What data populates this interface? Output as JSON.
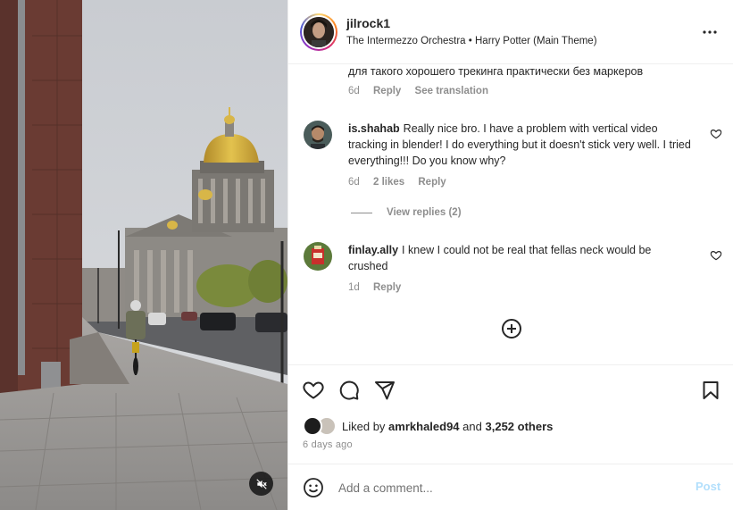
{
  "post": {
    "username": "jilrock1",
    "audio": "The Intermezzo Orchestra • Harry Potter (Main Theme)",
    "more_icon": "more-horizontal-icon"
  },
  "comments": [
    {
      "username": "",
      "text": "для такого хорошего трекинга практически без маркеров",
      "time": "6d",
      "likes": "",
      "reply": "Reply",
      "translate": "See translation"
    },
    {
      "username": "is.shahab",
      "text": "Really nice bro. I have a problem with vertical video tracking in blender! I do everything but it doesn't stick very well. I tried everything!!! Do you know why?",
      "time": "6d",
      "likes": "2 likes",
      "reply": "Reply",
      "view_replies": "View replies (2)"
    },
    {
      "username": "finlay.ally",
      "text": "I knew I could not be real that fellas neck would be crushed",
      "time": "1d",
      "reply": "Reply"
    }
  ],
  "actions": {
    "like_icon": "heart-icon",
    "comment_icon": "comment-icon",
    "share_icon": "paper-plane-icon",
    "save_icon": "bookmark-icon"
  },
  "likes": {
    "prefix": "Liked by",
    "user": "amrkhaled94",
    "conjunction": "and",
    "others": "3,252 others"
  },
  "time_ago": "6 days ago",
  "add_comment": {
    "placeholder": "Add a comment...",
    "post_label": "Post"
  },
  "colors": {
    "text": "#262626",
    "secondary": "#8e8e8e",
    "post_disabled": "#b2dffc",
    "border": "#efefef"
  }
}
